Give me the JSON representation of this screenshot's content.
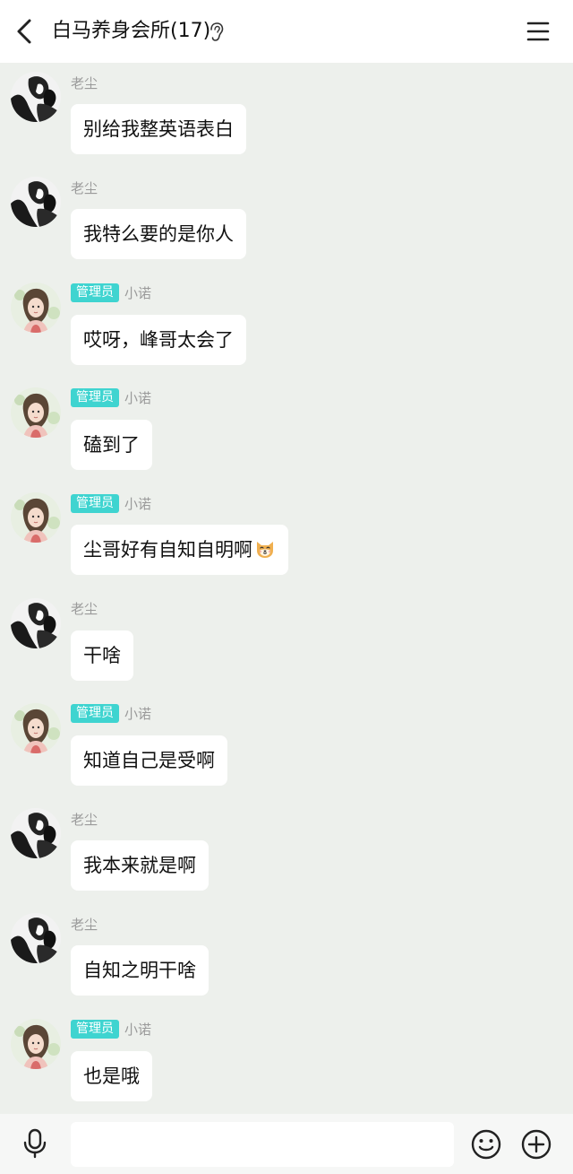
{
  "header": {
    "title": "白马养身会所(17)"
  },
  "messages": [
    {
      "sender": "老尘",
      "role": "",
      "text": "别给我整英语表白",
      "avatar": "bw"
    },
    {
      "sender": "老尘",
      "role": "",
      "text": "我特么要的是你人",
      "avatar": "bw"
    },
    {
      "sender": "小诺",
      "role": "管理员",
      "text": "哎呀，峰哥太会了",
      "avatar": "girl"
    },
    {
      "sender": "小诺",
      "role": "管理员",
      "text": "磕到了",
      "avatar": "girl"
    },
    {
      "sender": "小诺",
      "role": "管理员",
      "text": "尘哥好有自知自明啊",
      "avatar": "girl",
      "emoji": "shiba-face-icon"
    },
    {
      "sender": "老尘",
      "role": "",
      "text": "干啥",
      "avatar": "bw"
    },
    {
      "sender": "小诺",
      "role": "管理员",
      "text": "知道自己是受啊",
      "avatar": "girl"
    },
    {
      "sender": "老尘",
      "role": "",
      "text": "我本来就是啊",
      "avatar": "bw"
    },
    {
      "sender": "老尘",
      "role": "",
      "text": "自知之明干啥",
      "avatar": "bw"
    },
    {
      "sender": "小诺",
      "role": "管理员",
      "text": "也是哦",
      "avatar": "girl"
    }
  ],
  "input": {
    "value": "",
    "placeholder": ""
  },
  "colors": {
    "background": "#edf0ec",
    "badge": "#3fd4d0",
    "bubble": "#ffffff"
  }
}
